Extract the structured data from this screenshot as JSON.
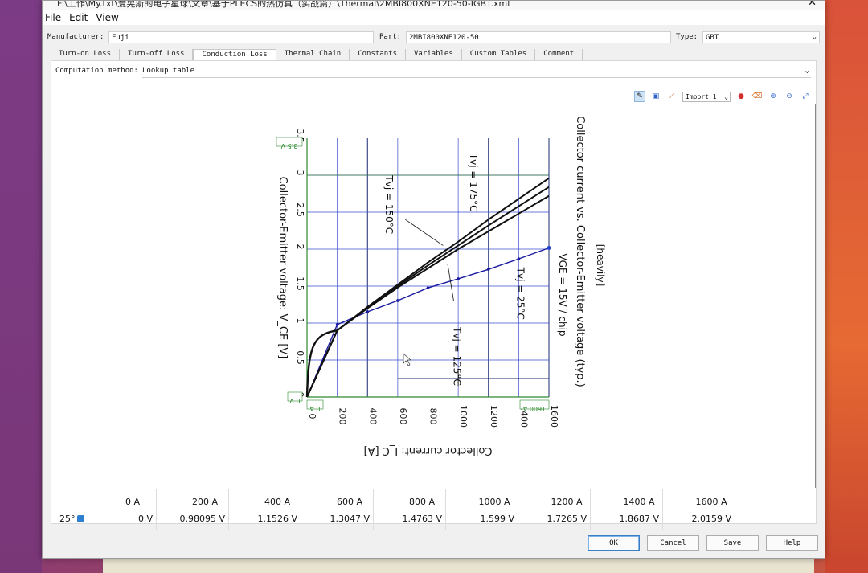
{
  "window": {
    "title": "F:\\工作\\My.txt\\爱晃斯的电子星球\\文章\\基于PLECS的热仿真（实战篇）\\Thermal\\2MBI800XNE120-50-IGBT.xml",
    "close": "✕"
  },
  "menu": [
    "File",
    "Edit",
    "View"
  ],
  "fields": {
    "manufacturer_label": "Manufacturer:",
    "manufacturer": "Fuji",
    "part_label": "Part:",
    "part": "2MBI800XNE120-50",
    "type_label": "Type:",
    "type": "GBT"
  },
  "tabs": [
    "Turn-on Loss",
    "Turn-off Loss",
    "Conduction Loss",
    "Thermal Chain",
    "Constants",
    "Variables",
    "Custom Tables",
    "Comment"
  ],
  "active_tab": 2,
  "method": {
    "label": "Computation method:",
    "value": "Lookup table"
  },
  "toolbar": {
    "import": "Import 1"
  },
  "plot": {
    "y_axis_title": "Collector-Emitter voltage: V_CE [V]",
    "x_axis_title": "Collector current: I_C [A]",
    "caption1": "Collector current vs. Collector-Emitter voltage (typ.)",
    "caption2": "[heavily]",
    "vge": "VGE = 15V / chip",
    "label_tj150": "Tvj = 150°C",
    "label_tj175": "Tvj = 175°C",
    "label_tj125": "Tvj = 125°C",
    "label_tj25": "Tvj = 25°C",
    "y_ticks": [
      "0",
      "0.5",
      "1",
      "1.5",
      "2",
      "2.5",
      "3",
      "3.5"
    ],
    "x_ticks": [
      "0",
      "200",
      "400",
      "600",
      "800",
      "1000",
      "1200",
      "1400",
      "1600"
    ],
    "v_min_tag": "0 V",
    "v_max_tag": "3.5 V",
    "i_min_tag": "0 A",
    "i_max_tag": "1600 A"
  },
  "chart_data": {
    "type": "line",
    "x": [
      0,
      200,
      400,
      600,
      800,
      1000,
      1200,
      1400,
      1600
    ],
    "series": [
      {
        "name": "Tvj = 25°C",
        "values": [
          0,
          0.98095,
          1.1526,
          1.3047,
          1.4763,
          1.599,
          1.7265,
          1.8687,
          2.0159
        ]
      },
      {
        "name": "Tvj = 125°C",
        "values": [
          0,
          0.9,
          1.2,
          1.48,
          1.74,
          2.0,
          2.24,
          2.48,
          2.72
        ]
      },
      {
        "name": "Tvj = 150°C",
        "values": [
          0,
          0.9,
          1.21,
          1.5,
          1.78,
          2.05,
          2.32,
          2.58,
          2.84
        ]
      },
      {
        "name": "Tvj = 175°C",
        "values": [
          0,
          0.9,
          1.22,
          1.52,
          1.82,
          2.1,
          2.4,
          2.68,
          2.96
        ]
      }
    ],
    "xlabel": "Collector current: I_C [A]",
    "ylabel": "Collector-Emitter voltage: V_CE [V]",
    "xlim": [
      0,
      1600
    ],
    "ylim": [
      0,
      3.5
    ],
    "grid": true,
    "color_fit": "#1a1aa0"
  },
  "table": {
    "headers": [
      "0 A",
      "200 A",
      "400 A",
      "600 A",
      "800 A",
      "1000 A",
      "1200 A",
      "1400 A",
      "1600 A"
    ],
    "row_label": "25°",
    "values": [
      "0 V",
      "0.98095 V",
      "1.1526 V",
      "1.3047 V",
      "1.4763 V",
      "1.599 V",
      "1.7265 V",
      "1.8687 V",
      "2.0159 V"
    ]
  },
  "buttons": {
    "ok": "OK",
    "cancel": "Cancel",
    "save": "Save",
    "help": "Help"
  }
}
